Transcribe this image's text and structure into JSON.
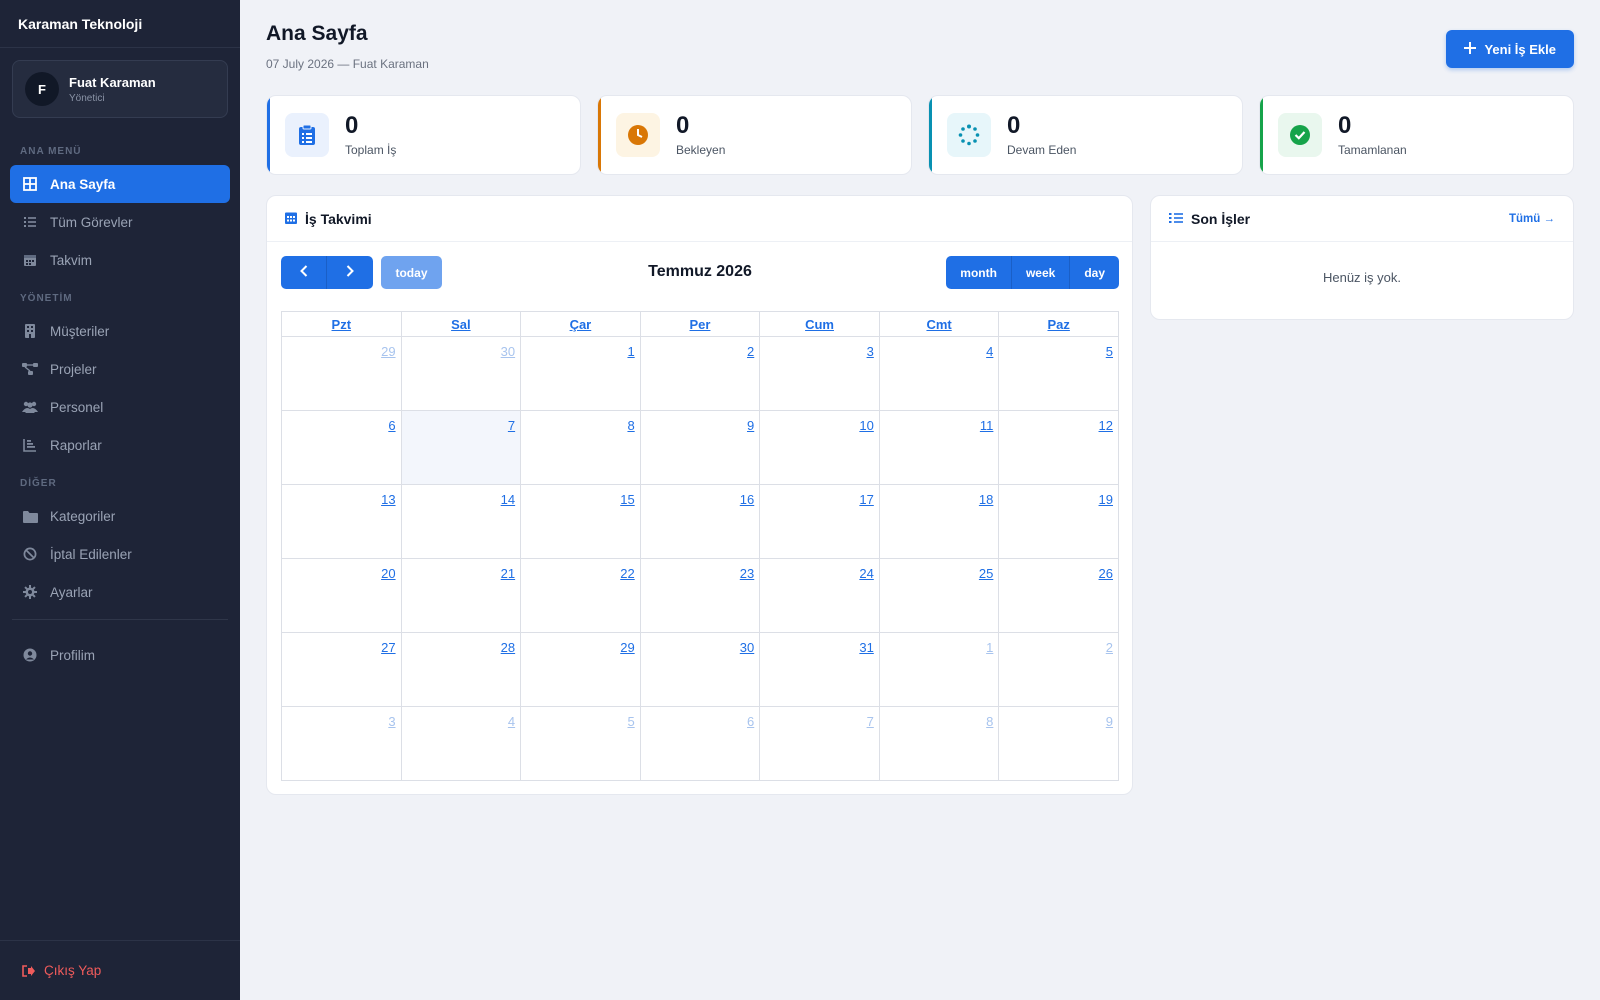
{
  "sidebar": {
    "brand": "Karaman Teknoloji",
    "user": {
      "initial": "F",
      "name": "Fuat Karaman",
      "role": "Yönetici"
    },
    "sections": {
      "main_menu": "ANA MENÜ",
      "management": "YÖNETİM",
      "other": "DİĞER"
    },
    "items": {
      "home": "Ana Sayfa",
      "all_tasks": "Tüm Görevler",
      "calendar": "Takvim",
      "customers": "Müşteriler",
      "projects": "Projeler",
      "staff": "Personel",
      "reports": "Raporlar",
      "categories": "Kategoriler",
      "cancelled": "İptal Edilenler",
      "settings": "Ayarlar",
      "profile": "Profilim"
    },
    "logout": "Çıkış Yap"
  },
  "header": {
    "title": "Ana Sayfa",
    "subtitle": "07 July 2026 — Fuat Karaman",
    "new_button": "Yeni İş Ekle"
  },
  "stats": {
    "total": {
      "value": "0",
      "label": "Toplam İş",
      "color": "#1f6fe5"
    },
    "pending": {
      "value": "0",
      "label": "Bekleyen",
      "color": "#d97706"
    },
    "in_progress": {
      "value": "0",
      "label": "Devam Eden",
      "color": "#0891b2"
    },
    "completed": {
      "value": "0",
      "label": "Tamamlanan",
      "color": "#16a34a"
    }
  },
  "calendar": {
    "card_title": "İş Takvimi",
    "title": "Temmuz 2026",
    "today_label": "today",
    "views": {
      "month": "month",
      "week": "week",
      "day": "day"
    },
    "weekdays": [
      "Pzt",
      "Sal",
      "Çar",
      "Per",
      "Cum",
      "Cmt",
      "Paz"
    ],
    "weeks": [
      [
        "29",
        "30",
        "1",
        "2",
        "3",
        "4",
        "5"
      ],
      [
        "6",
        "7",
        "8",
        "9",
        "10",
        "11",
        "12"
      ],
      [
        "13",
        "14",
        "15",
        "16",
        "17",
        "18",
        "19"
      ],
      [
        "20",
        "21",
        "22",
        "23",
        "24",
        "25",
        "26"
      ],
      [
        "27",
        "28",
        "29",
        "30",
        "31",
        "1",
        "2"
      ],
      [
        "3",
        "4",
        "5",
        "6",
        "7",
        "8",
        "9"
      ]
    ]
  },
  "recent": {
    "title": "Son İşler",
    "see_all": "Tümü →",
    "empty": "Henüz iş yok."
  }
}
